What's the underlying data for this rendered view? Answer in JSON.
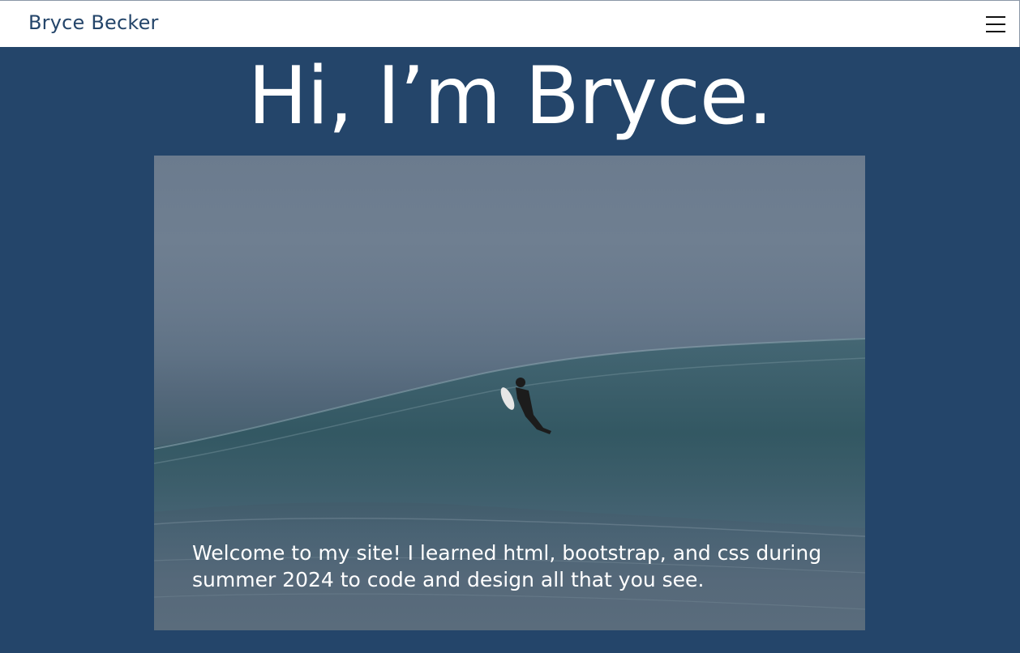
{
  "navbar": {
    "brand": "Bryce Becker",
    "menu_icon": "hamburger-menu-icon"
  },
  "hero": {
    "title": "Hi, I’m Bryce.",
    "image_subject": "surfer-on-wave-photo",
    "caption": "Welcome to my site! I learned html, bootstrap, and css during summer 2024 to code and design all that you see."
  },
  "colors": {
    "background": "#24456a",
    "navbar": "#ffffff",
    "brand_text": "#24456a",
    "text": "#ffffff"
  }
}
